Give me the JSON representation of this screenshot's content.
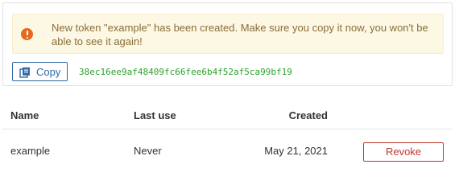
{
  "alert": {
    "icon": "warning-circle-icon",
    "message": "New token \"example\" has been created. Make sure you copy it now, you won't be able to see it again!",
    "colors": {
      "background": "#fcf8e3",
      "text": "#8a6d3b",
      "icon": "#e36a1f"
    }
  },
  "copy": {
    "label": "Copy",
    "icon": "copy-document-icon",
    "color": "#2e6aa6"
  },
  "token": {
    "value": "38ec16ee9af48409fc66fee6b4f52af5ca99bf19",
    "color": "#2ca02c"
  },
  "table": {
    "headers": {
      "name": "Name",
      "last_use": "Last use",
      "created": "Created"
    },
    "rows": [
      {
        "name": "example",
        "last_use": "Never",
        "created": "May 21, 2021",
        "action": "Revoke"
      }
    ],
    "revoke_color": "#c0392b"
  }
}
